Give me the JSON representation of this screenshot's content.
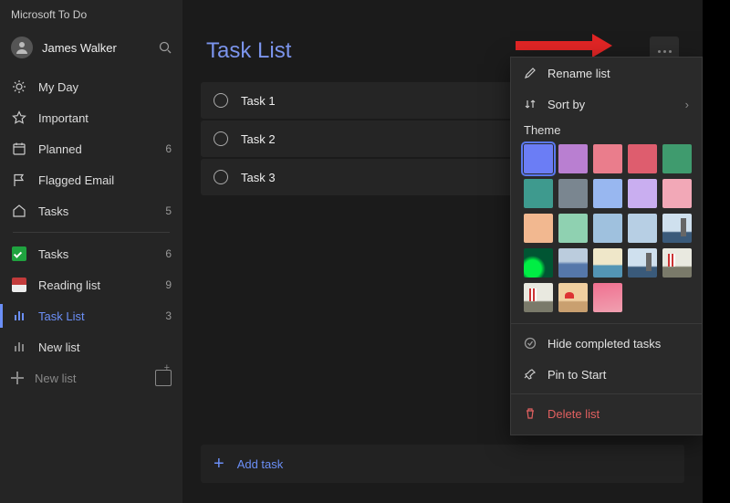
{
  "app_title": "Microsoft To Do",
  "profile": {
    "name": "James Walker"
  },
  "sidebar": {
    "smart_lists": [
      {
        "label": "My Day",
        "count": ""
      },
      {
        "label": "Important",
        "count": ""
      },
      {
        "label": "Planned",
        "count": "6"
      },
      {
        "label": "Flagged Email",
        "count": ""
      },
      {
        "label": "Tasks",
        "count": "5"
      }
    ],
    "custom_lists": [
      {
        "label": "Tasks",
        "count": "6"
      },
      {
        "label": "Reading list",
        "count": "9"
      },
      {
        "label": "Task List",
        "count": "3"
      },
      {
        "label": "New list",
        "count": ""
      }
    ],
    "new_list_label": "New list"
  },
  "main": {
    "title": "Task List",
    "tasks": [
      {
        "label": "Task 1"
      },
      {
        "label": "Task 2"
      },
      {
        "label": "Task 3"
      }
    ],
    "add_task_label": "Add task"
  },
  "menu": {
    "rename": "Rename list",
    "sort": "Sort by",
    "theme_label": "Theme",
    "hide_completed": "Hide completed tasks",
    "pin": "Pin to Start",
    "delete": "Delete list",
    "swatches": [
      {
        "color": "#6b7df5",
        "selected": true
      },
      {
        "color": "#b97fd1"
      },
      {
        "color": "#ea7d8c"
      },
      {
        "color": "#de5d6e"
      },
      {
        "color": "#3f9b6e"
      },
      {
        "color": "#3e9a8e"
      },
      {
        "color": "#7a8690"
      },
      {
        "color": "#98b7f0"
      },
      {
        "color": "#c9aef0"
      },
      {
        "color": "#f2a8b7"
      },
      {
        "color": "#f2b890"
      },
      {
        "color": "#8fd1b1"
      },
      {
        "color": "#9fc1de"
      },
      {
        "color": "#b7cfe4"
      },
      {
        "photo": "ph4"
      },
      {
        "photo": "ph1"
      },
      {
        "photo": "ph2"
      },
      {
        "photo": "ph3"
      },
      {
        "photo": "ph4"
      },
      {
        "photo": "ph5"
      },
      {
        "photo": "ph5"
      },
      {
        "photo": "ph6"
      },
      {
        "photo": "ph7"
      }
    ]
  }
}
